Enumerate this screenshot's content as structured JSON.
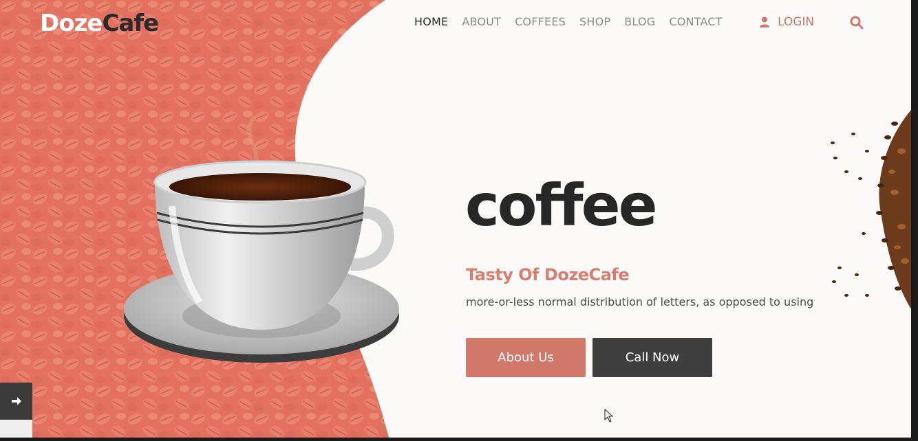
{
  "brand": {
    "part1": "Doze",
    "part2": "Cafe"
  },
  "nav": {
    "items": [
      {
        "label": "HOME",
        "active": true
      },
      {
        "label": "ABOUT"
      },
      {
        "label": "COFFEES"
      },
      {
        "label": "SHOP"
      },
      {
        "label": "BLOG"
      },
      {
        "label": "CONTACT"
      }
    ],
    "login_label": "LOGIN"
  },
  "hero": {
    "title": "coffee",
    "subtitle": "Tasty Of DozeCafe",
    "description": "more-or-less normal distribution of letters, as opposed to using",
    "about_button": "About Us",
    "call_button": "Call Now"
  },
  "colors": {
    "accent": "#d17868",
    "dark": "#3f3f3f",
    "bean_bg": "#e2705e"
  },
  "icons": {
    "user": "user-icon",
    "search": "search-icon",
    "arrow": "arrow-right-icon"
  }
}
